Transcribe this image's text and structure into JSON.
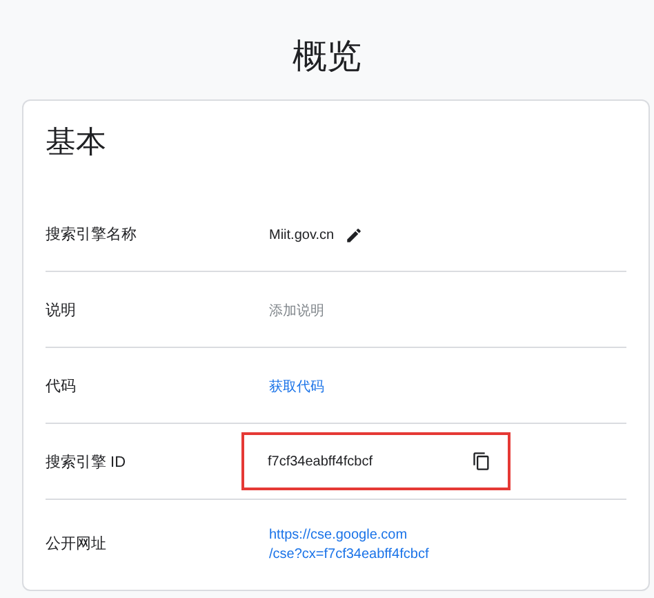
{
  "page_title": "概览",
  "card": {
    "heading": "基本",
    "rows": [
      {
        "label": "搜索引擎名称",
        "kind": "editable",
        "value": "Miit.gov.cn",
        "highlighted": false
      },
      {
        "label": "说明",
        "kind": "placeholder",
        "value": "添加说明",
        "highlighted": false
      },
      {
        "label": "代码",
        "kind": "link",
        "value": "获取代码",
        "highlighted": false
      },
      {
        "label": "搜索引擎 ID",
        "kind": "copyable",
        "value": "f7cf34eabff4fcbcf",
        "highlighted": true
      },
      {
        "label": "公开网址",
        "kind": "link_lines",
        "lines": [
          "https://cse.google.com",
          "/cse?cx=f7cf34eabff4fcbcf"
        ],
        "highlighted": false
      }
    ]
  }
}
